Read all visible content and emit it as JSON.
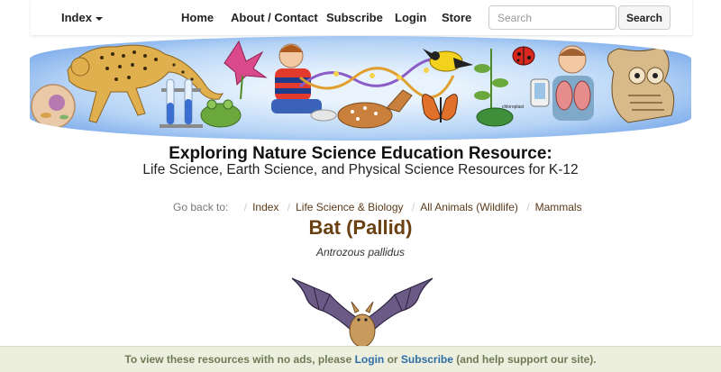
{
  "navbar": {
    "index_label": "Index",
    "links": [
      "Home",
      "About / Contact",
      "Subscribe",
      "Login",
      "Store"
    ],
    "search_placeholder": "Search",
    "search_button": "Search"
  },
  "header": {
    "title": "Exploring Nature Science Education Resource:",
    "subtitle": "Life Science, Earth Science, and Physical Science Resources for K-12"
  },
  "breadcrumb": {
    "prefix": "Go back to:",
    "separator": "/",
    "items": [
      "Index",
      "Life Science & Biology",
      "All Animals (Wildlife)",
      "Mammals"
    ]
  },
  "page": {
    "title": "Bat (Pallid)",
    "scientific_name": "Antrozous pallidus"
  },
  "banner": {
    "chloroplast_label": "chloroplast"
  },
  "ad_bar": {
    "before": "To view these resources with no ads, please ",
    "login": "Login",
    "middle": " or ",
    "subscribe": "Subscribe",
    "after": " (and help support our site)."
  },
  "colors": {
    "title_brown": "#6b4012",
    "link_brown": "#5b3a1a",
    "ad_text": "#6e7b55",
    "ad_link": "#2e6da4",
    "ad_background": "#ecefde"
  }
}
